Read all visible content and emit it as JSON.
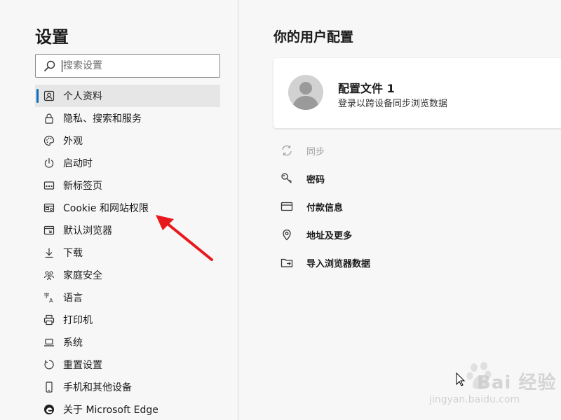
{
  "sidebar": {
    "title": "设置",
    "search": {
      "placeholder": "搜索设置",
      "value": ""
    },
    "items": [
      {
        "label": "个人资料",
        "icon": "profile-icon",
        "active": true
      },
      {
        "label": "隐私、搜索和服务",
        "icon": "lock-icon"
      },
      {
        "label": "外观",
        "icon": "palette-icon"
      },
      {
        "label": "启动时",
        "icon": "power-icon"
      },
      {
        "label": "新标签页",
        "icon": "new-tab-icon"
      },
      {
        "label": "Cookie 和网站权限",
        "icon": "site-permissions-icon"
      },
      {
        "label": "默认浏览器",
        "icon": "default-browser-icon"
      },
      {
        "label": "下载",
        "icon": "download-icon"
      },
      {
        "label": "家庭安全",
        "icon": "family-icon"
      },
      {
        "label": "语言",
        "icon": "language-icon"
      },
      {
        "label": "打印机",
        "icon": "printer-icon"
      },
      {
        "label": "系统",
        "icon": "laptop-icon"
      },
      {
        "label": "重置设置",
        "icon": "reset-icon"
      },
      {
        "label": "手机和其他设备",
        "icon": "phone-icon"
      },
      {
        "label": "关于 Microsoft Edge",
        "icon": "edge-logo-icon"
      }
    ]
  },
  "main": {
    "title": "你的用户配置",
    "profile": {
      "name": "配置文件 1",
      "subtitle": "登录以跨设备同步浏览数据"
    },
    "options": [
      {
        "label": "同步",
        "icon": "sync-icon",
        "disabled": true
      },
      {
        "label": "密码",
        "icon": "key-icon"
      },
      {
        "label": "付款信息",
        "icon": "card-icon"
      },
      {
        "label": "地址及更多",
        "icon": "location-icon"
      },
      {
        "label": "导入浏览器数据",
        "icon": "import-icon"
      }
    ]
  },
  "watermark": {
    "brand": "Bai 经验",
    "url": "jingyan.baidu.com"
  },
  "colors": {
    "accent": "#0f6cbd",
    "annotation_arrow": "#e8191c"
  }
}
